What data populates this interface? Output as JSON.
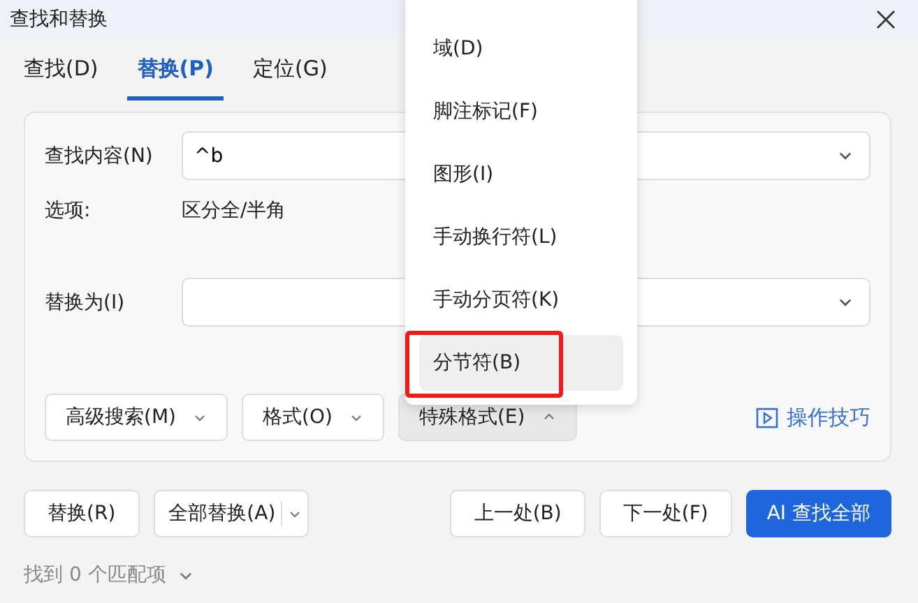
{
  "window": {
    "title": "查找和替换"
  },
  "tabs": [
    {
      "label": "查找(D)",
      "selected": false
    },
    {
      "label": "替换(P)",
      "selected": true
    },
    {
      "label": "定位(G)",
      "selected": false
    }
  ],
  "find": {
    "label": "查找内容(N)",
    "value": "^b"
  },
  "options": {
    "label": "选项:",
    "value": "区分全/半角"
  },
  "replace": {
    "label": "替换为(I)"
  },
  "option_buttons": [
    {
      "label": "高级搜索(M)",
      "open": false
    },
    {
      "label": "格式(O)",
      "open": false
    },
    {
      "label": "特殊格式(E)",
      "open": true
    }
  ],
  "tips_link": "操作技巧",
  "actions": [
    {
      "label": "替换(R)",
      "kind": "plain"
    },
    {
      "label": "全部替换(A)",
      "kind": "split"
    },
    {
      "label": "上一处(B)",
      "kind": "plain"
    },
    {
      "label": "下一处(F)",
      "kind": "plain"
    },
    {
      "label": "AI 查找全部",
      "kind": "primary"
    }
  ],
  "status": "找到 0 个匹配项",
  "menu": [
    {
      "label": "域(D)",
      "selected": false
    },
    {
      "label": "脚注标记(F)",
      "selected": false
    },
    {
      "label": "图形(I)",
      "selected": false
    },
    {
      "label": "手动换行符(L)",
      "selected": false
    },
    {
      "label": "手动分页符(K)",
      "selected": false
    },
    {
      "label": "分节符(B)",
      "selected": true
    }
  ]
}
